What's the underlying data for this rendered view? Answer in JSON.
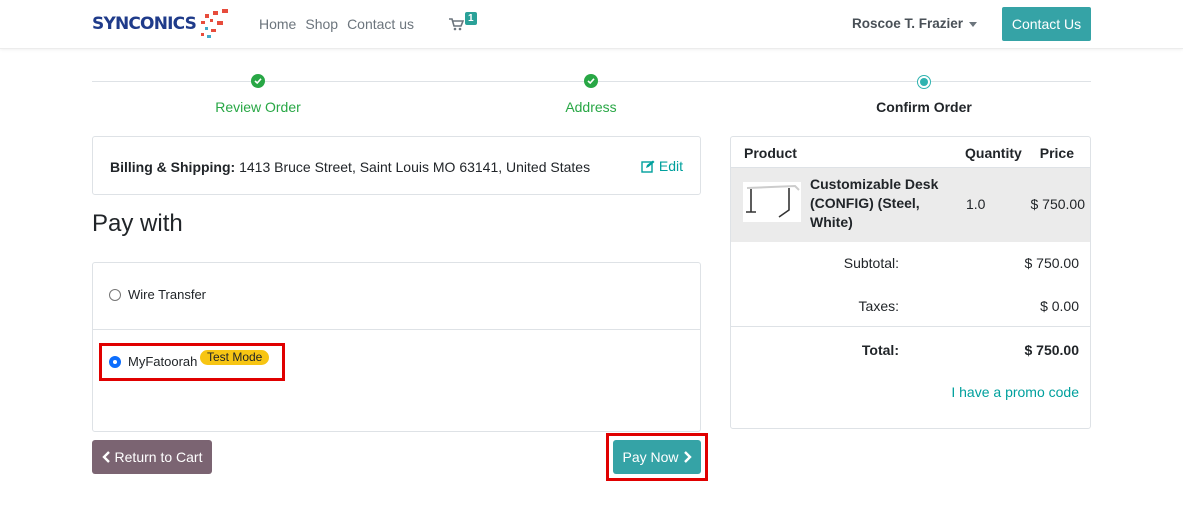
{
  "header": {
    "logo_text": "SYNCONICS",
    "nav": [
      "Home",
      "Shop",
      "Contact us"
    ],
    "cart_count": "1",
    "user_name": "Roscoe T. Frazier",
    "contact_button": "Contact Us"
  },
  "wizard": {
    "steps": [
      {
        "label": "Review Order",
        "state": "done"
      },
      {
        "label": "Address",
        "state": "done"
      },
      {
        "label": "Confirm Order",
        "state": "current"
      }
    ]
  },
  "billing": {
    "label": "Billing & Shipping:",
    "address": " 1413 Bruce Street, Saint Louis MO 63141, United States",
    "edit_label": "Edit"
  },
  "payment": {
    "heading": "Pay with",
    "methods": [
      {
        "label": "Wire Transfer",
        "selected": false
      },
      {
        "label": "MyFatoorah",
        "selected": true,
        "badge": "Test Mode"
      }
    ]
  },
  "actions": {
    "return_label": "Return to Cart",
    "pay_label": "Pay Now"
  },
  "summary": {
    "headers": {
      "product": "Product",
      "quantity": "Quantity",
      "price": "Price"
    },
    "items": [
      {
        "name": "Customizable Desk (CONFIG) (Steel, White)",
        "quantity": "1.0",
        "price": "$ 750.00"
      }
    ],
    "subtotal_label": "Subtotal:",
    "subtotal": "$ 750.00",
    "taxes_label": "Taxes:",
    "taxes": "$ 0.00",
    "total_label": "Total:",
    "total": "$ 750.00",
    "promo_label": "I have a promo code"
  },
  "colors": {
    "accent": "#35a3a6",
    "success": "#28a745",
    "link": "#00a09d",
    "return_button": "#7b6472",
    "badge": "#f7c513",
    "highlight": "#e00000"
  }
}
